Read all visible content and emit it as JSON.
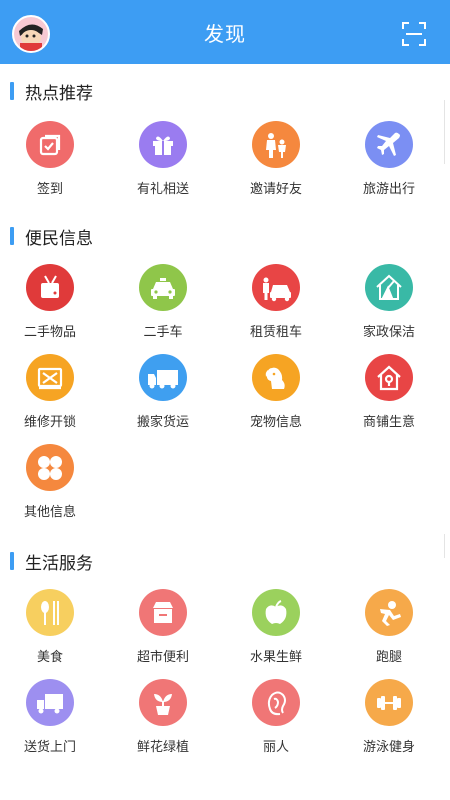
{
  "header": {
    "title": "发现"
  },
  "sections": [
    {
      "title": "热点推荐",
      "items": [
        {
          "label": "签到",
          "icon": "checkin-icon",
          "color": "#f06b6b"
        },
        {
          "label": "有礼相送",
          "icon": "gift-icon",
          "color": "#9a7cf0"
        },
        {
          "label": "邀请好友",
          "icon": "invite-icon",
          "color": "#f5883e"
        },
        {
          "label": "旅游出行",
          "icon": "plane-icon",
          "color": "#7b8ff3"
        }
      ]
    },
    {
      "title": "便民信息",
      "items": [
        {
          "label": "二手物品",
          "icon": "secondhand-icon",
          "color": "#e03a3a"
        },
        {
          "label": "二手车",
          "icon": "car-icon",
          "color": "#8fc64a"
        },
        {
          "label": "租赁租车",
          "icon": "rental-car-icon",
          "color": "#e84545"
        },
        {
          "label": "家政保洁",
          "icon": "housekeeping-icon",
          "color": "#39b9a6"
        },
        {
          "label": "维修开锁",
          "icon": "repair-icon",
          "color": "#f6a423"
        },
        {
          "label": "搬家货运",
          "icon": "truck-icon",
          "color": "#3f9ff0"
        },
        {
          "label": "宠物信息",
          "icon": "pet-icon",
          "color": "#f6a423"
        },
        {
          "label": "商铺生意",
          "icon": "shop-icon",
          "color": "#e84545"
        },
        {
          "label": "其他信息",
          "icon": "other-icon",
          "color": "#f5883e"
        }
      ]
    },
    {
      "title": "生活服务",
      "items": [
        {
          "label": "美食",
          "icon": "food-icon",
          "color": "#f7cf5f"
        },
        {
          "label": "超市便利",
          "icon": "supermarket-icon",
          "color": "#f07676"
        },
        {
          "label": "水果生鲜",
          "icon": "fruit-icon",
          "color": "#9bd15d"
        },
        {
          "label": "跑腿",
          "icon": "errand-icon",
          "color": "#f6a94a"
        },
        {
          "label": "送货上门",
          "icon": "delivery-icon",
          "color": "#9d8ff0"
        },
        {
          "label": "鲜花绿植",
          "icon": "flower-icon",
          "color": "#f07676"
        },
        {
          "label": "丽人",
          "icon": "beauty-icon",
          "color": "#f07676"
        },
        {
          "label": "游泳健身",
          "icon": "fitness-icon",
          "color": "#f6a94a"
        }
      ]
    }
  ]
}
